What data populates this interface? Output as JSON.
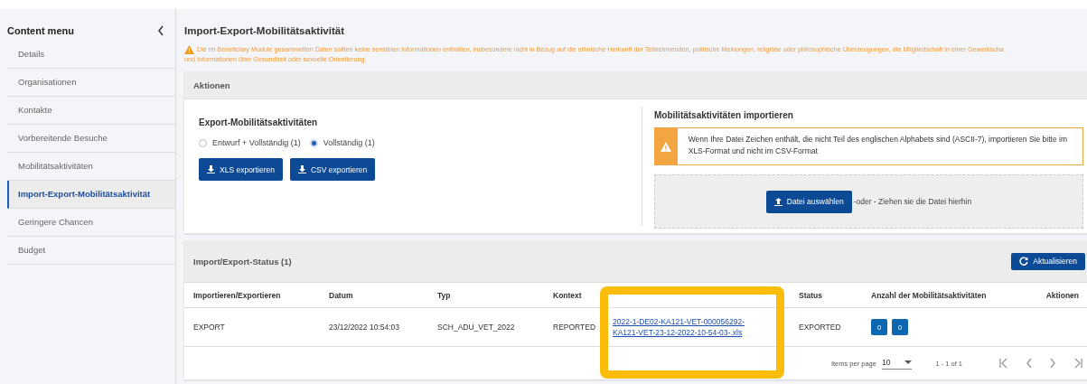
{
  "sidebar": {
    "title": "Content menu",
    "items": [
      {
        "label": "Details",
        "selected": false
      },
      {
        "label": "Organisationen",
        "selected": false
      },
      {
        "label": "Kontakte",
        "selected": false
      },
      {
        "label": "Vorbereitende Besuche",
        "selected": false
      },
      {
        "label": "Mobilitätsaktivitäten",
        "selected": false
      },
      {
        "label": "Import-Export-Mobilitätsaktivität",
        "selected": true
      },
      {
        "label": "Geringere Chancen",
        "selected": false
      },
      {
        "label": "Budget",
        "selected": false
      }
    ]
  },
  "page": {
    "title": "Import-Export-Mobilitätsaktivität",
    "warning_lines": [
      "Die im Beneficiary Module gesammelten Daten sollten keine sensiblen Informationen enthalten, insbesondere nicht in Bezug auf die ethnische Herkunft der Teilnehmenden, politische Meinungen, religiöse oder philosophische Überzeugungen, die Mitgliedschaft in einer Gewerkscha",
      "und Informationen über Gesundheit oder sexuelle Orientierung."
    ]
  },
  "actions": {
    "title": "Aktionen",
    "export": {
      "title": "Export-Mobilitätsaktivitäten",
      "options": [
        {
          "label": "Entwurf + Vollständig (1)",
          "selected": false
        },
        {
          "label": "Vollständig (1)",
          "selected": true
        }
      ],
      "buttons": [
        "XLS exportieren",
        "CSV exportieren"
      ]
    },
    "import": {
      "title": "Mobilitätsaktivitäten importieren",
      "notice": "Wenn Ihre Datei Zeichen enthält, die nicht Teil des englischen Alphabets sind (ASCII-7), importieren Sie bitte im XLS-Format und nicht im CSV-Format",
      "button": "Datei auswählen",
      "drop_hint": "-oder - Ziehen sie die Datei hierhin"
    }
  },
  "status": {
    "title": "Import/Export-Status (1)",
    "refresh_button": "Aktualisieren",
    "columns": [
      "Importieren/Exportieren",
      "Datum",
      "Typ",
      "Kontext",
      "",
      "Status",
      "Anzahl der Mobilitätsaktivitäten",
      "Aktionen"
    ],
    "rows": [
      {
        "direction": "EXPORT",
        "date": "23/12/2022 10:54:03",
        "type": "SCH_ADU_VET_2022",
        "context": "REPORTED",
        "file_lines": [
          "2022-1-DE02-KA121-VET-000056292-",
          "KA121-VET-23-12-2022-10-54-03-.xls"
        ],
        "state": "EXPORTED",
        "counts": [
          "0",
          "0"
        ],
        "highlighted": true
      }
    ],
    "pagination": {
      "items_per_page_label": "Items per page",
      "items_per_page": "10",
      "range": "1 - 1 of 1"
    }
  }
}
